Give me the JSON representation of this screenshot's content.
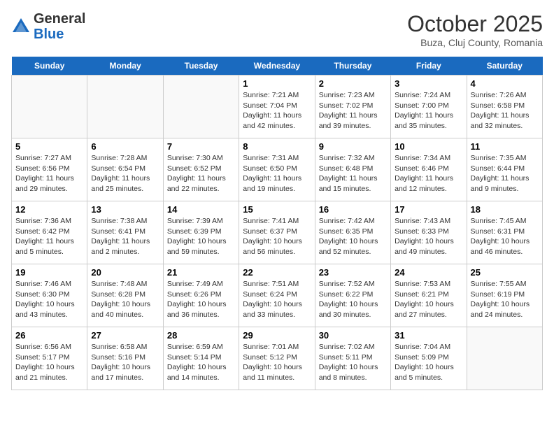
{
  "header": {
    "logo_general": "General",
    "logo_blue": "Blue",
    "month": "October 2025",
    "location": "Buza, Cluj County, Romania"
  },
  "days_of_week": [
    "Sunday",
    "Monday",
    "Tuesday",
    "Wednesday",
    "Thursday",
    "Friday",
    "Saturday"
  ],
  "weeks": [
    [
      {
        "day": "",
        "info": ""
      },
      {
        "day": "",
        "info": ""
      },
      {
        "day": "",
        "info": ""
      },
      {
        "day": "1",
        "info": "Sunrise: 7:21 AM\nSunset: 7:04 PM\nDaylight: 11 hours and 42 minutes."
      },
      {
        "day": "2",
        "info": "Sunrise: 7:23 AM\nSunset: 7:02 PM\nDaylight: 11 hours and 39 minutes."
      },
      {
        "day": "3",
        "info": "Sunrise: 7:24 AM\nSunset: 7:00 PM\nDaylight: 11 hours and 35 minutes."
      },
      {
        "day": "4",
        "info": "Sunrise: 7:26 AM\nSunset: 6:58 PM\nDaylight: 11 hours and 32 minutes."
      }
    ],
    [
      {
        "day": "5",
        "info": "Sunrise: 7:27 AM\nSunset: 6:56 PM\nDaylight: 11 hours and 29 minutes."
      },
      {
        "day": "6",
        "info": "Sunrise: 7:28 AM\nSunset: 6:54 PM\nDaylight: 11 hours and 25 minutes."
      },
      {
        "day": "7",
        "info": "Sunrise: 7:30 AM\nSunset: 6:52 PM\nDaylight: 11 hours and 22 minutes."
      },
      {
        "day": "8",
        "info": "Sunrise: 7:31 AM\nSunset: 6:50 PM\nDaylight: 11 hours and 19 minutes."
      },
      {
        "day": "9",
        "info": "Sunrise: 7:32 AM\nSunset: 6:48 PM\nDaylight: 11 hours and 15 minutes."
      },
      {
        "day": "10",
        "info": "Sunrise: 7:34 AM\nSunset: 6:46 PM\nDaylight: 11 hours and 12 minutes."
      },
      {
        "day": "11",
        "info": "Sunrise: 7:35 AM\nSunset: 6:44 PM\nDaylight: 11 hours and 9 minutes."
      }
    ],
    [
      {
        "day": "12",
        "info": "Sunrise: 7:36 AM\nSunset: 6:42 PM\nDaylight: 11 hours and 5 minutes."
      },
      {
        "day": "13",
        "info": "Sunrise: 7:38 AM\nSunset: 6:41 PM\nDaylight: 11 hours and 2 minutes."
      },
      {
        "day": "14",
        "info": "Sunrise: 7:39 AM\nSunset: 6:39 PM\nDaylight: 10 hours and 59 minutes."
      },
      {
        "day": "15",
        "info": "Sunrise: 7:41 AM\nSunset: 6:37 PM\nDaylight: 10 hours and 56 minutes."
      },
      {
        "day": "16",
        "info": "Sunrise: 7:42 AM\nSunset: 6:35 PM\nDaylight: 10 hours and 52 minutes."
      },
      {
        "day": "17",
        "info": "Sunrise: 7:43 AM\nSunset: 6:33 PM\nDaylight: 10 hours and 49 minutes."
      },
      {
        "day": "18",
        "info": "Sunrise: 7:45 AM\nSunset: 6:31 PM\nDaylight: 10 hours and 46 minutes."
      }
    ],
    [
      {
        "day": "19",
        "info": "Sunrise: 7:46 AM\nSunset: 6:30 PM\nDaylight: 10 hours and 43 minutes."
      },
      {
        "day": "20",
        "info": "Sunrise: 7:48 AM\nSunset: 6:28 PM\nDaylight: 10 hours and 40 minutes."
      },
      {
        "day": "21",
        "info": "Sunrise: 7:49 AM\nSunset: 6:26 PM\nDaylight: 10 hours and 36 minutes."
      },
      {
        "day": "22",
        "info": "Sunrise: 7:51 AM\nSunset: 6:24 PM\nDaylight: 10 hours and 33 minutes."
      },
      {
        "day": "23",
        "info": "Sunrise: 7:52 AM\nSunset: 6:22 PM\nDaylight: 10 hours and 30 minutes."
      },
      {
        "day": "24",
        "info": "Sunrise: 7:53 AM\nSunset: 6:21 PM\nDaylight: 10 hours and 27 minutes."
      },
      {
        "day": "25",
        "info": "Sunrise: 7:55 AM\nSunset: 6:19 PM\nDaylight: 10 hours and 24 minutes."
      }
    ],
    [
      {
        "day": "26",
        "info": "Sunrise: 6:56 AM\nSunset: 5:17 PM\nDaylight: 10 hours and 21 minutes."
      },
      {
        "day": "27",
        "info": "Sunrise: 6:58 AM\nSunset: 5:16 PM\nDaylight: 10 hours and 17 minutes."
      },
      {
        "day": "28",
        "info": "Sunrise: 6:59 AM\nSunset: 5:14 PM\nDaylight: 10 hours and 14 minutes."
      },
      {
        "day": "29",
        "info": "Sunrise: 7:01 AM\nSunset: 5:12 PM\nDaylight: 10 hours and 11 minutes."
      },
      {
        "day": "30",
        "info": "Sunrise: 7:02 AM\nSunset: 5:11 PM\nDaylight: 10 hours and 8 minutes."
      },
      {
        "day": "31",
        "info": "Sunrise: 7:04 AM\nSunset: 5:09 PM\nDaylight: 10 hours and 5 minutes."
      },
      {
        "day": "",
        "info": ""
      }
    ]
  ]
}
